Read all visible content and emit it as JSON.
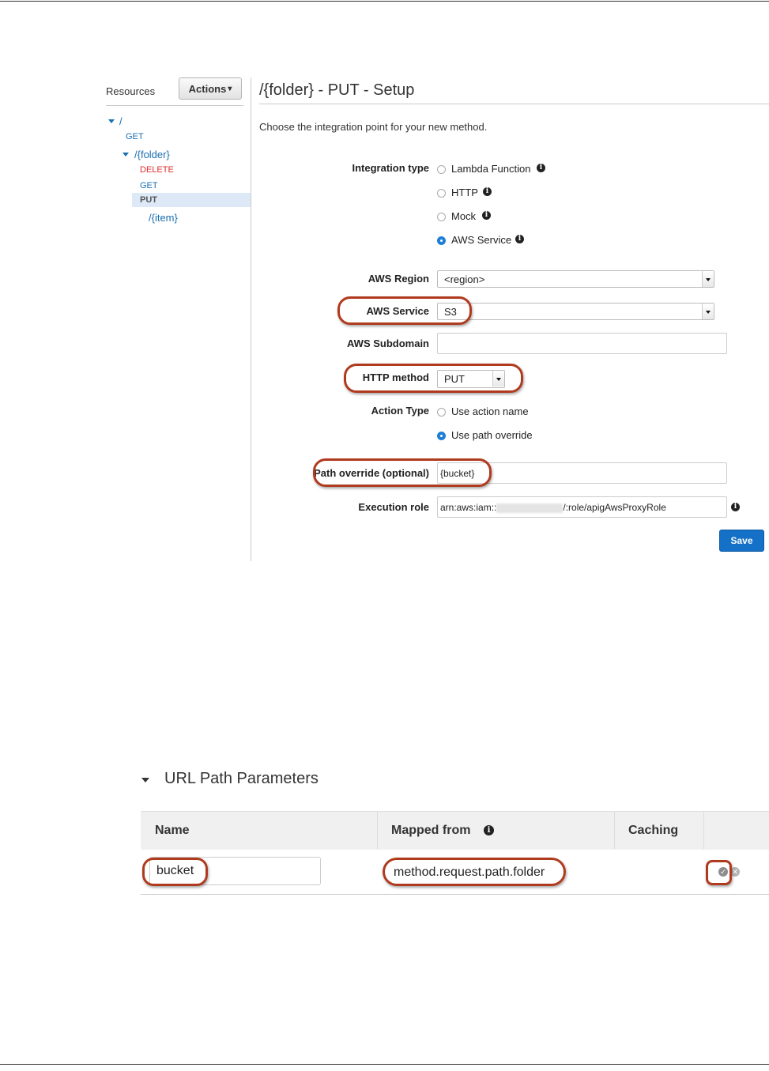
{
  "sidebar": {
    "resources_label": "Resources",
    "actions_label": "Actions",
    "actions_caret": "▾",
    "tree": {
      "root": "/",
      "root_get": "GET",
      "folder": "/{folder}",
      "delete": "DELETE",
      "get": "GET",
      "put": "PUT",
      "item": "/{item}"
    }
  },
  "main": {
    "title": "/{folder} - PUT - Setup",
    "description": "Choose the integration point for your new method.",
    "integration_type": {
      "label": "Integration type",
      "options": [
        "Lambda Function",
        "HTTP",
        "Mock",
        "AWS Service"
      ],
      "selected": "AWS Service"
    },
    "aws_region": {
      "label": "AWS Region",
      "value": "<region>"
    },
    "aws_service": {
      "label": "AWS Service",
      "value": "S3"
    },
    "aws_subdomain": {
      "label": "AWS Subdomain",
      "value": ""
    },
    "http_method": {
      "label": "HTTP method",
      "value": "PUT"
    },
    "action_type": {
      "label": "Action Type",
      "options": [
        "Use action name",
        "Use path override"
      ],
      "selected": "Use path override"
    },
    "path_override": {
      "label": "Path override (optional)",
      "value": "{bucket}"
    },
    "execution_role": {
      "label": "Execution role",
      "prefix": "arn:aws:iam::",
      "suffix": "/:role/apigAwsProxyRole"
    },
    "save_label": "Save"
  },
  "url_path_params": {
    "title": "URL Path Parameters",
    "columns": [
      "Name",
      "Mapped from",
      "Caching"
    ],
    "rows": [
      {
        "name": "bucket",
        "mapped_from": "method.request.path.folder"
      }
    ]
  },
  "icons": {
    "info": "info-icon",
    "confirm": "check-icon",
    "cancel": "close-icon"
  },
  "colors": {
    "accent": "#1571c7",
    "highlight_oval": "#b03a1e",
    "delete": "#e02d2d",
    "link": "#1a6fb0"
  }
}
